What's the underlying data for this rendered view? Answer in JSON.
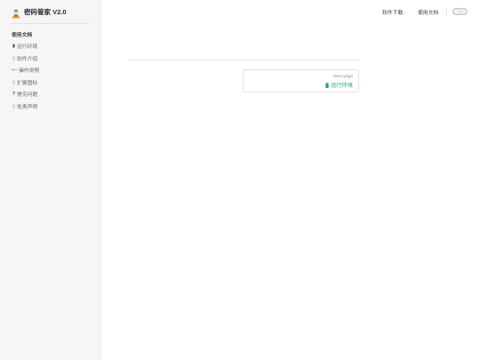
{
  "brand": {
    "title": "密码管家 V2.0",
    "logo_icon": "user-avatar-icon"
  },
  "sidebar": {
    "group_title": "使用文档",
    "items": [
      {
        "icon": "▮",
        "icon_name": "battery-icon",
        "label": "运行环境"
      },
      {
        "icon": "▯",
        "icon_name": "box-icon",
        "label": "软件介绍"
      },
      {
        "icon": "⟵",
        "icon_name": "arrow-icon",
        "label": "操作说明"
      },
      {
        "icon": "▯",
        "icon_name": "box-icon",
        "label": "扩展图标"
      },
      {
        "icon": "?",
        "icon_name": "question-icon",
        "label": "常见问题"
      },
      {
        "icon": "▯",
        "icon_name": "box-icon",
        "label": "免责声明"
      }
    ]
  },
  "topbar": {
    "download_label": "软件下载",
    "download_caret": "˅",
    "docs_label": "使用文档",
    "theme_toggle": "off"
  },
  "pager": {
    "desc": "Next page",
    "title": "运行环境",
    "title_icon": "battery-icon"
  },
  "colors": {
    "accent": "#2ea86b",
    "sidebar_bg": "#f6f6f7"
  }
}
